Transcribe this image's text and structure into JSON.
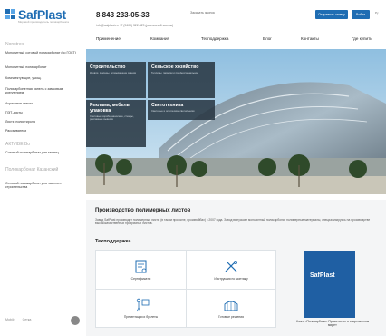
{
  "brand": {
    "name": "SafPlast",
    "tagline": "Мировой производитель поликарбоната"
  },
  "header": {
    "phone": "8 843 233-05-33",
    "callback": "Заказать звонок",
    "email_line": "info@safplast.ru  +7 (9600) 322-429 (различный звонок)",
    "send_request": "Отправить заявку",
    "login": "Войти",
    "lang": "Ру"
  },
  "nav": {
    "items": [
      "Применение",
      "Компания",
      "Техподдержка",
      "Блог",
      "Контакты",
      "Где купить"
    ]
  },
  "sidebar": {
    "heading": "Nonstrex",
    "items": [
      "Монолитный сотовый поликарбонат (по ГОСТ)",
      "Монолитный поликарбонат",
      "Комплектующие, умощ.",
      "Поликарбонатная панель с замковым креплением",
      "Акриловое стекло",
      "ПЭТ-листы",
      "Листы полистирола",
      "Рассеиватели"
    ],
    "sale_heading": "АКТИВЕ Во",
    "sale_item": "Сотовый поликарбонат для теплиц",
    "city_heading": "Поликарбонат Казанский",
    "city_item": "Сотовый поликарбонат для частного строительства",
    "footer_mobile": "Mobile",
    "footer_phone": "Сетка"
  },
  "hero": {
    "tiles": [
      {
        "title": "Строительство",
        "desc": "Кровли, фасады, ограждающие здания"
      },
      {
        "title": "Сельское хозяйство",
        "desc": "Теплицы, парники и профессиональное"
      },
      {
        "title": "Реклама, мебель, упаковка",
        "desc": "Световые короба, наносные, стенды, рекламные вывески"
      },
      {
        "title": "Светотехника",
        "desc": "Световые и оптические светильники"
      }
    ]
  },
  "content": {
    "title": "Производство полимерных листов",
    "text": "Завод SafPlast производит полимерные листы (в таком профиле, произвойбах) с 2007 года. Завод выпускает монолитный поликарбонат полимерные материалы, специализируясь на производстве высококачественных прозрачных листов.",
    "support_title": "Техподдержка",
    "cells": [
      {
        "label": "Сертификаты",
        "icon": "certificate-icon"
      },
      {
        "label": "Инструкция по монтажу",
        "icon": "tools-icon"
      },
      {
        "label": "Презентации и буклеты",
        "icon": "presentation-icon"
      },
      {
        "label": "Готовые решения",
        "icon": "greenhouse-icon"
      }
    ],
    "book_brand": "SafPlast",
    "book_caption": "Книга «Поликарбонат. Применение в современном мире»"
  },
  "colors": {
    "brand": "#1f6db3",
    "tile_bg": "#263440",
    "content_bg": "#f4f5f6"
  }
}
